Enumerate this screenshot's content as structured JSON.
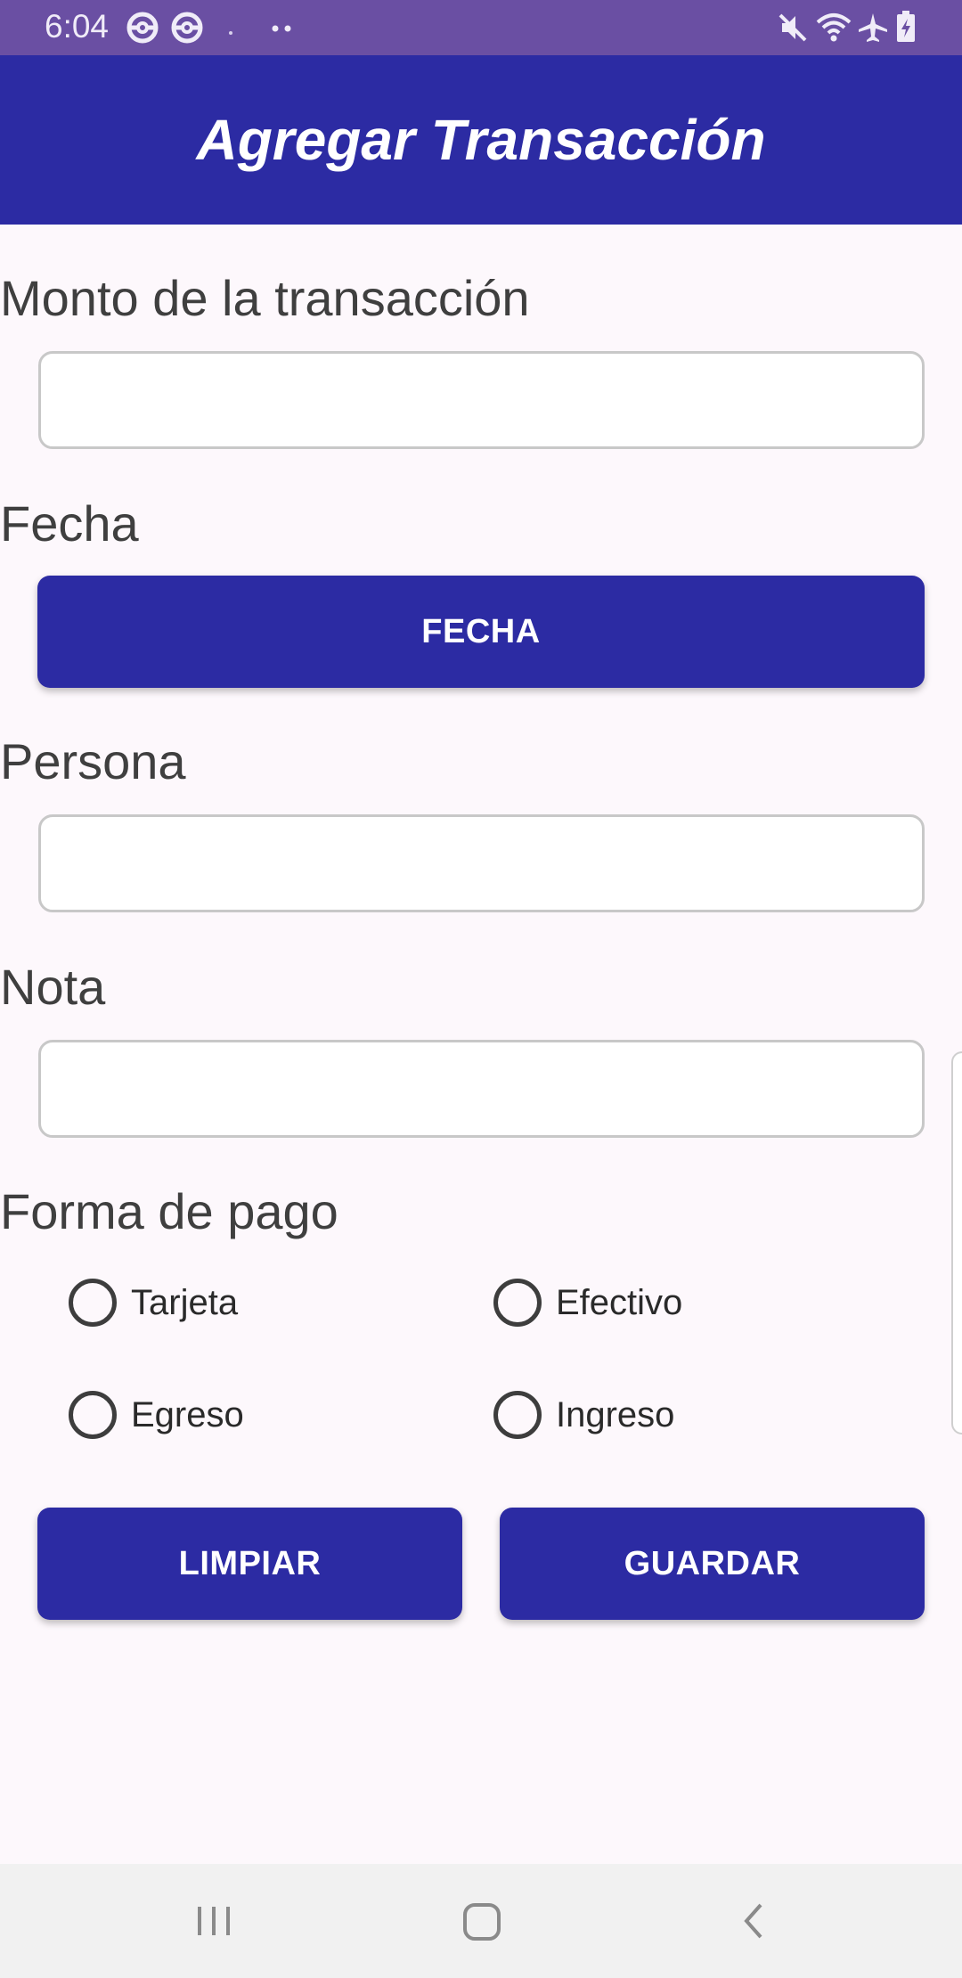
{
  "status_bar": {
    "time": "6:04",
    "left_icons": [
      "pokeball-icon",
      "pokeball-icon",
      "dot-icon",
      "more-dots-icon"
    ],
    "right_icons": [
      "mute-icon",
      "wifi-icon",
      "airplane-mode-icon",
      "battery-charging-icon"
    ]
  },
  "app_bar": {
    "title": "Agregar Transacción"
  },
  "form": {
    "amount": {
      "label": "Monto de la transacción",
      "value": "",
      "placeholder": ""
    },
    "date": {
      "label": "Fecha",
      "button_label": "FECHA"
    },
    "person": {
      "label": "Persona",
      "value": "",
      "placeholder": ""
    },
    "note": {
      "label": "Nota",
      "value": "",
      "placeholder": ""
    },
    "payment": {
      "label": "Forma de pago",
      "options": [
        "Tarjeta",
        "Efectivo",
        "Egreso",
        "Ingreso"
      ]
    },
    "clear_label": "LIMPIAR",
    "save_label": "GUARDAR"
  },
  "colors": {
    "status_bar": "#6a4fa3",
    "primary": "#2c2ba3",
    "background": "#fdf8fc",
    "nav_bar": "#f1f1f1"
  },
  "nav_bar": {
    "buttons": [
      "recent-apps-icon",
      "home-icon",
      "back-icon"
    ]
  }
}
